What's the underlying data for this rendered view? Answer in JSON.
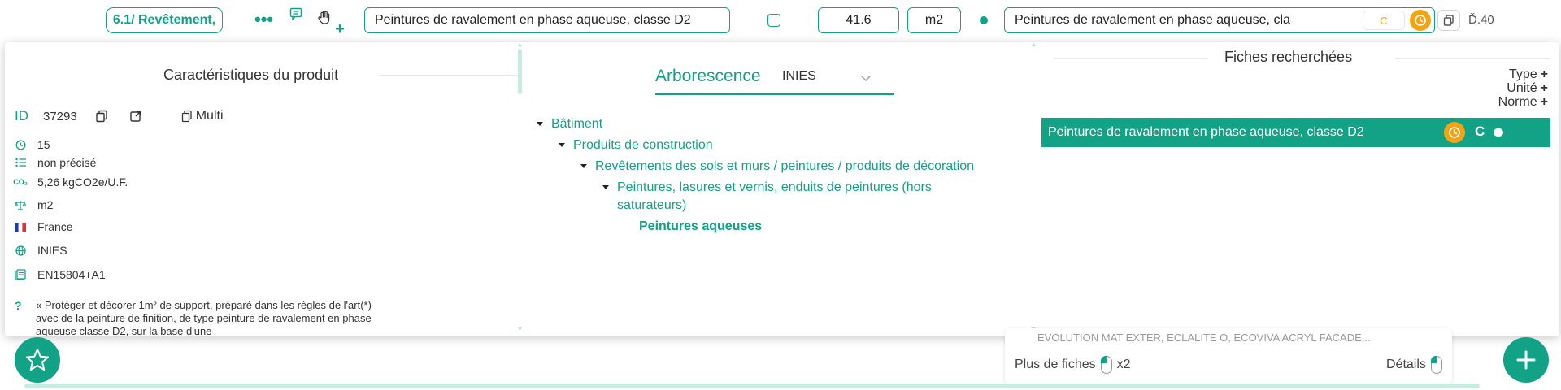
{
  "toprow": {
    "lot_label": "6.1/ Revêtement,",
    "more_label": "•••",
    "designation": "Peintures de ravalement en phase aqueuse, classe D2",
    "quantity": "41.6",
    "unit": "m2",
    "fiche_name": "Peintures de ravalement en phase aqueuse, cla",
    "conformity_badge": "C",
    "price": "Ď.40",
    "icons": [
      "comment-icon",
      "drag-hand-icon",
      "plus-icon",
      "clock-icon",
      "copy-icon"
    ],
    "accent_color": "#12a285",
    "warning_color": "#f2a413"
  },
  "product": {
    "title": "Caractéristiques du produit",
    "id_label": "ID",
    "id_value": "37293",
    "multi_label": "Multi",
    "duration": "15",
    "category": "non précisé",
    "carbon": "5,26 kgCO2e/U.F.",
    "unit": "m2",
    "country": "France",
    "source": "INIES",
    "norm": "EN15804+A1",
    "description_q": "?",
    "description": "« Protéger et décorer 1m² de support, préparé dans les règles de l'art(*) avec de la peinture de finition, de type peinture de ravalement en phase aqueuse classe D2, sur la base d'une"
  },
  "tree": {
    "title": "Arborescence",
    "selected_source": "INIES",
    "nodes": [
      {
        "label": "Bâtiment"
      },
      {
        "label": "Produits de construction"
      },
      {
        "label": "Revêtements des sols et murs / peintures / produits de décoration"
      },
      {
        "label": "Peintures, lasures et vernis, enduits de peintures (hors"
      },
      {
        "label": "saturateurs)"
      },
      {
        "label": "Peintures aqueuses"
      }
    ]
  },
  "fiches": {
    "title": "Fiches recherchées",
    "filters": [
      {
        "label": "Type",
        "action": "+"
      },
      {
        "label": "Unité",
        "action": "+"
      },
      {
        "label": "Norme",
        "action": "+"
      }
    ],
    "result_label": "Peintures de ravalement en phase aqueuse, classe D2",
    "result_badge": "C"
  },
  "bottom": {
    "peek_text": "EVOLUTION MAT EXTER, ECLALITE O, ECOVIVA ACRYL FACADE,...",
    "more_label": "Plus de fiches",
    "multiplier": "x2",
    "details_label": "Détails"
  }
}
